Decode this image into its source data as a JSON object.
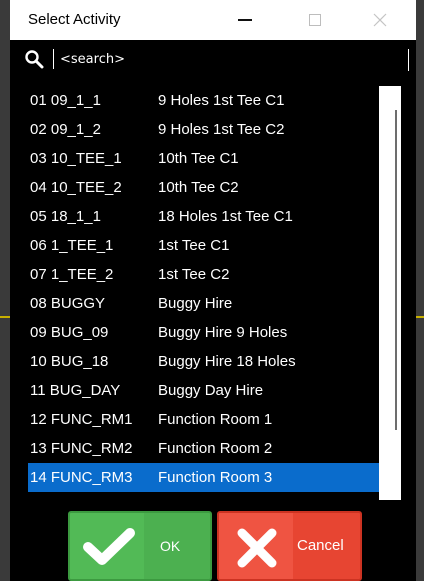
{
  "window": {
    "title": "Select Activity"
  },
  "search": {
    "placeholder": "<search>",
    "value": ""
  },
  "activities": [
    {
      "code": "01 09_1_1",
      "description": "9 Holes 1st Tee C1"
    },
    {
      "code": "02 09_1_2",
      "description": "9 Holes 1st Tee C2"
    },
    {
      "code": "03 10_TEE_1",
      "description": "10th Tee C1"
    },
    {
      "code": "04 10_TEE_2",
      "description": "10th Tee C2"
    },
    {
      "code": "05 18_1_1",
      "description": "18 Holes 1st Tee C1"
    },
    {
      "code": "06 1_TEE_1",
      "description": "1st Tee C1"
    },
    {
      "code": "07 1_TEE_2",
      "description": "1st Tee C2"
    },
    {
      "code": "08 BUGGY",
      "description": "Buggy Hire"
    },
    {
      "code": "09 BUG_09",
      "description": "Buggy Hire 9 Holes"
    },
    {
      "code": "10 BUG_18",
      "description": "Buggy Hire 18 Holes"
    },
    {
      "code": "11 BUG_DAY",
      "description": "Buggy Day Hire"
    },
    {
      "code": "12 FUNC_RM1",
      "description": "Function Room 1"
    },
    {
      "code": "13 FUNC_RM2",
      "description": "Function Room 2"
    },
    {
      "code": "14 FUNC_RM3",
      "description": "Function Room 3"
    }
  ],
  "selected_index": 13,
  "buttons": {
    "ok_label": "OK",
    "cancel_label": "Cancel"
  },
  "colors": {
    "selection": "#0a6ccc",
    "ok": "#4cb050",
    "cancel": "#e74532"
  }
}
